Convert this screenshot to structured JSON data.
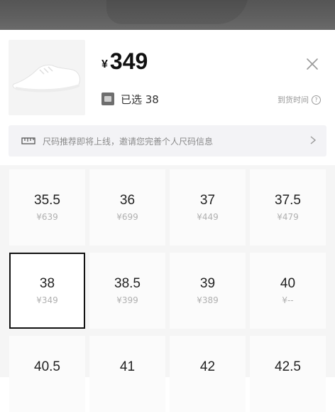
{
  "product": {
    "currency": "¥",
    "price": "349",
    "selected_label": "已选 38",
    "arrival_label": "到货时间",
    "arrival_help": "?"
  },
  "banner": {
    "text": "尺码推荐即将上线，邀请您完善个人尺码信息"
  },
  "sizes": [
    {
      "size": "35.5",
      "price": "¥639"
    },
    {
      "size": "36",
      "price": "¥699"
    },
    {
      "size": "37",
      "price": "¥449"
    },
    {
      "size": "37.5",
      "price": "¥479"
    },
    {
      "size": "38",
      "price": "¥349",
      "selected": true
    },
    {
      "size": "38.5",
      "price": "¥399"
    },
    {
      "size": "39",
      "price": "¥389"
    },
    {
      "size": "40",
      "price": "¥--"
    },
    {
      "size": "40.5",
      "price": ""
    },
    {
      "size": "41",
      "price": ""
    },
    {
      "size": "42",
      "price": ""
    },
    {
      "size": "42.5",
      "price": ""
    }
  ],
  "icons": {
    "close": "close-icon",
    "ruler": "ruler-icon",
    "chevron": "chevron-right-icon",
    "selected": "selected-thumb-icon",
    "help": "help-circle-icon"
  },
  "colors": {
    "selected_border": "#111111",
    "grid_background": "#f5f5f5"
  }
}
